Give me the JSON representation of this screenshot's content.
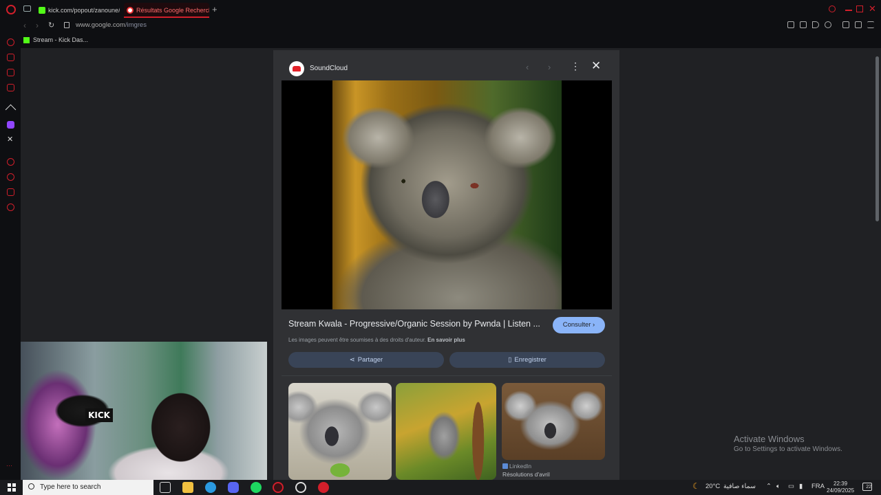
{
  "browser": {
    "tabs": [
      {
        "label": "kick.com/popout/zanoune/"
      },
      {
        "label": "Résultats Google Recherche"
      }
    ],
    "new_tab": "+",
    "url_domain": "www.google.com",
    "url_path": "/imgres",
    "bookmark": "Stream - Kick Das..."
  },
  "panel": {
    "source_name": "SoundCloud",
    "title": "Stream Kwala - Progressive/Organic Session by Pwnda | Listen ...",
    "visit_button": "Consulter",
    "rights_text": "Les images peuvent être soumises à des droits d'auteur.",
    "rights_link": "En savoir plus",
    "share_button": "Partager",
    "save_button": "Enregistrer",
    "related": [
      {
        "source": "",
        "caption": ""
      },
      {
        "source": "",
        "caption": ""
      },
      {
        "source": "LinkedIn",
        "caption": "Résolutions d'avril"
      }
    ]
  },
  "webcam": {
    "sign_text": "KICK"
  },
  "activate": {
    "title": "Activate Windows",
    "subtitle": "Go to Settings to activate Windows."
  },
  "taskbar": {
    "search_placeholder": "Type here to search",
    "weather_temp": "20°C",
    "weather_desc": "سماء صافية",
    "language": "FRA",
    "time": "22:39",
    "date": "24/09/2025",
    "notification_count": "22"
  },
  "colors": {
    "accent": "#d21f2b",
    "consulter_bg": "#8ab4f8",
    "action_bg": "#394457",
    "panel_bg": "#303134",
    "page_bg": "#202124"
  }
}
